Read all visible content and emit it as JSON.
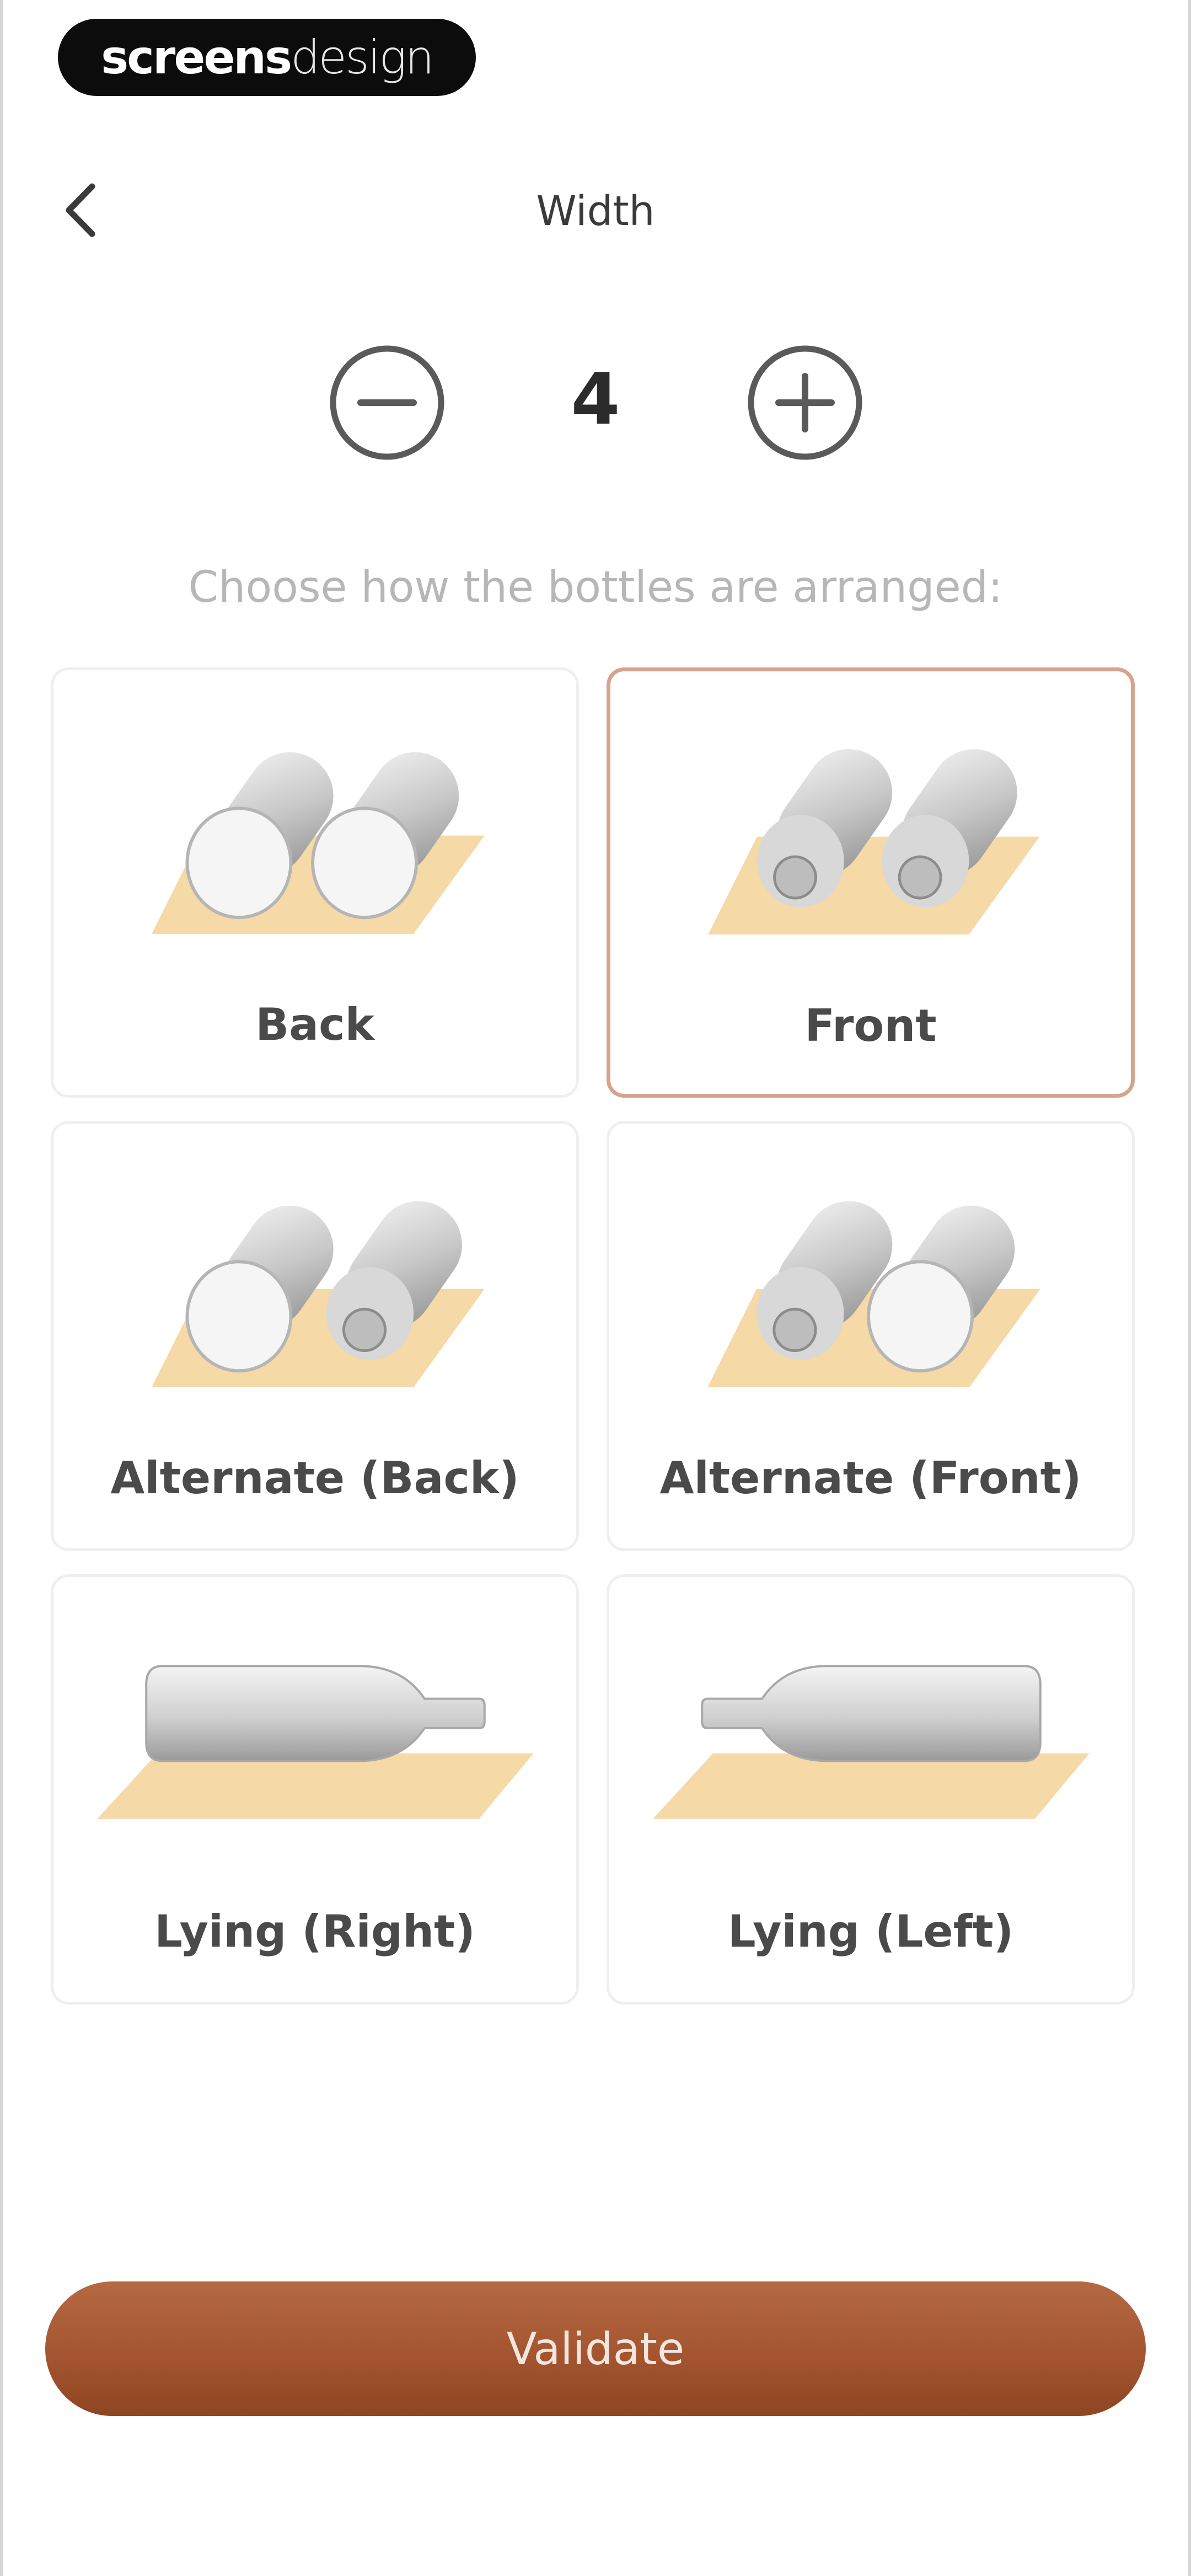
{
  "branding": {
    "part1": "screens",
    "part2": "design"
  },
  "header": {
    "title": "Width"
  },
  "stepper": {
    "value": "4"
  },
  "prompt": "Choose how the bottles are arranged:",
  "options": [
    {
      "label": "Back",
      "selected": false
    },
    {
      "label": "Front",
      "selected": true
    },
    {
      "label": "Alternate (Back)",
      "selected": false
    },
    {
      "label": "Alternate (Front)",
      "selected": false
    },
    {
      "label": "Lying (Right)",
      "selected": false
    },
    {
      "label": "Lying (Left)",
      "selected": false
    }
  ],
  "validate_label": "Validate",
  "colors": {
    "accent": "#a45530",
    "selected_border": "#d6a48d",
    "shelf": "#f5d9a6",
    "bottle": "#d9d9d9"
  }
}
